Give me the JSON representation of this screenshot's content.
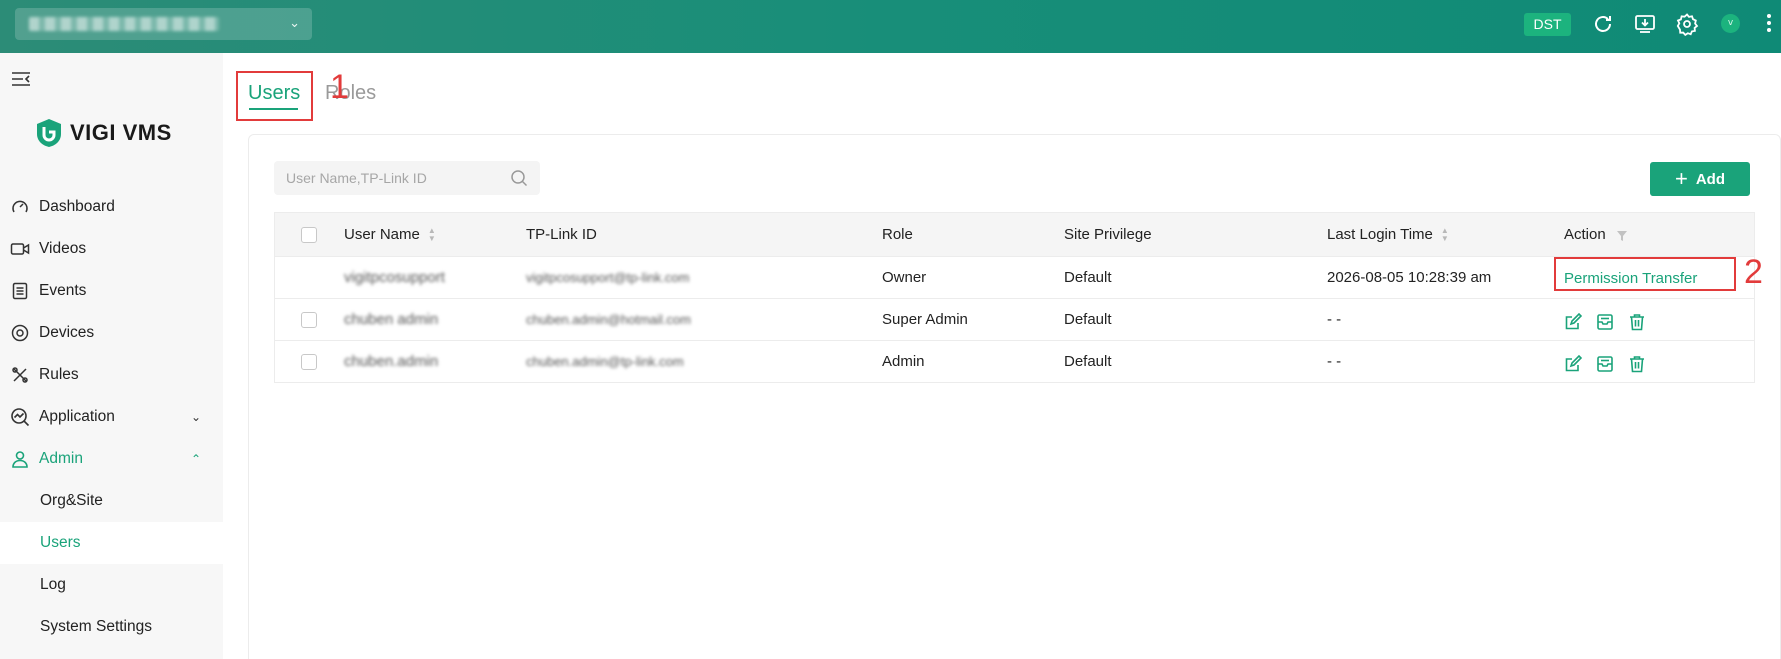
{
  "topbar": {
    "site_selector_value": "▒▒▒▒▒ ▒▒▒▒▒▒",
    "dst_label": "DST",
    "avatar_initial": "v",
    "colors": {
      "bar": "#188e79",
      "accent": "#1cb37e"
    }
  },
  "sidebar": {
    "logo_text": "VIGI VMS",
    "items": [
      {
        "label": "Dashboard",
        "icon": "gauge-icon"
      },
      {
        "label": "Videos",
        "icon": "video-camera-icon"
      },
      {
        "label": "Events",
        "icon": "list-icon"
      },
      {
        "label": "Devices",
        "icon": "target-icon"
      },
      {
        "label": "Rules",
        "icon": "tools-icon"
      },
      {
        "label": "Application",
        "icon": "chart-search-icon"
      },
      {
        "label": "Admin",
        "icon": "user-icon"
      }
    ],
    "admin_sub_items": [
      {
        "label": "Org&Site"
      },
      {
        "label": "Users"
      },
      {
        "label": "Log"
      },
      {
        "label": "System Settings"
      }
    ],
    "active_color": "#1aa37a"
  },
  "tabs": {
    "users": "Users",
    "roles": "Roles",
    "annotation_1": "1",
    "annotation_2": "2"
  },
  "toolbar": {
    "search_placeholder": "User Name,TP-Link ID",
    "add_label": "Add"
  },
  "table": {
    "headers": {
      "user_name": "User Name",
      "tplink_id": "TP-Link ID",
      "role": "Role",
      "site_privilege": "Site Privilege",
      "last_login": "Last Login Time",
      "action": "Action"
    },
    "rows": [
      {
        "user_name": "vigitpcosupport",
        "tplink_id": "vigitpcosupport@tp-link.com",
        "role": "Owner",
        "site_privilege": "Default",
        "last_login": "2026-08-05 10:28:39 am",
        "action": "Permission Transfer"
      },
      {
        "user_name": "chuben admin",
        "tplink_id": "chuben.admin@hotmail.com",
        "role": "Super Admin",
        "site_privilege": "Default",
        "last_login": "- -",
        "action": ""
      },
      {
        "user_name": "chuben.admin",
        "tplink_id": "chuben.admin@tp-link.com",
        "role": "Admin",
        "site_privilege": "Default",
        "last_login": "- -",
        "action": ""
      }
    ]
  }
}
